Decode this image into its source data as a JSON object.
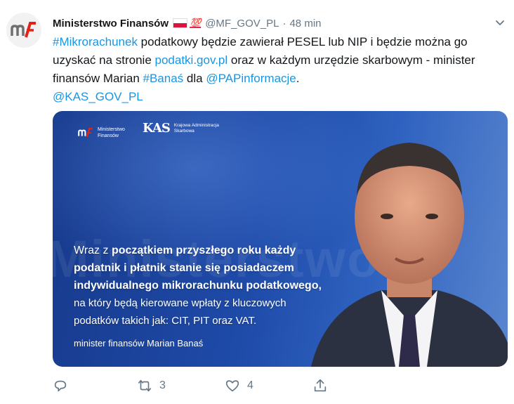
{
  "tweet": {
    "author": {
      "name": "Ministerstwo Finansów",
      "emoji_flag": "flag-poland-icon",
      "emoji_hundred": "💯",
      "handle": "@MF_GOV_PL",
      "separator": "·",
      "time": "48 min",
      "avatar_icon": "ministerstwo-finansow-logo-icon"
    },
    "text": {
      "hashtag1": "#Mikrorachunek",
      "part1": " podatkowy będzie zawierał PESEL lub NIP i będzie można go uzyskać na stronie ",
      "link1": "podatki.gov.pl",
      "part2": " oraz w każdym urzędzie skarbowym - minister finansów Marian ",
      "hashtag2": "#Banaś",
      "part3": " dla ",
      "mention1": "@PAPinformacje",
      "part4": ".",
      "mention2": "@KAS_GOV_PL"
    },
    "card": {
      "logo1_text_line1": "Ministerstwo",
      "logo1_text_line2": "Finansów",
      "logo2_mark": "KAS",
      "logo2_text_line1": "Krajowa Administracja",
      "logo2_text_line2": "Skarbowa",
      "background_word": "Ministerstwo",
      "quote_line1_regular": "Wraz z ",
      "quote_line1_bold": "początkiem przyszłego roku każdy",
      "quote_line2_bold": "podatnik i płatnik stanie się posiadaczem",
      "quote_line3_bold": "indywidualnego mikrorachunku podatkowego,",
      "quote_line4": "na który będą kierowane wpłaty z kluczowych",
      "quote_line5": "podatków takich jak: CIT, PIT oraz VAT.",
      "signature": "minister finansów Marian Banaś"
    },
    "actions": {
      "reply_icon": "reply-icon",
      "retweet_icon": "retweet-icon",
      "retweet_count": "3",
      "like_icon": "heart-icon",
      "like_count": "4",
      "share_icon": "share-icon"
    },
    "colors": {
      "link": "#1b95e0",
      "secondary": "#657786",
      "brand_red": "#e2231a"
    }
  }
}
